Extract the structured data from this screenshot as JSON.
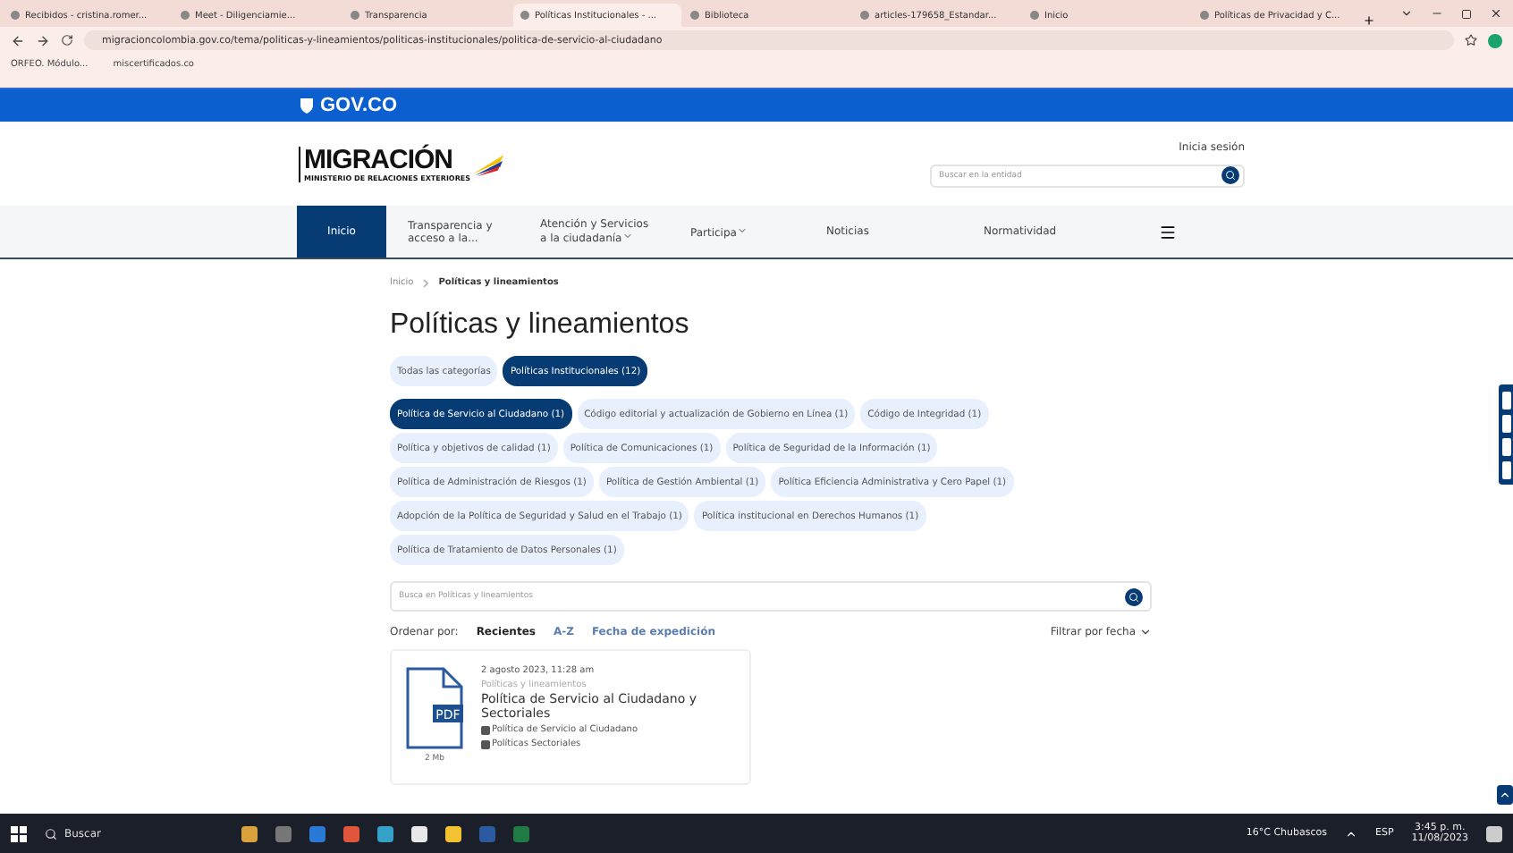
{
  "browser": {
    "tabs": [
      {
        "label": "Recibidos - cristina.romer...",
        "selected": false
      },
      {
        "label": "Meet - Diligenciamie...",
        "selected": false
      },
      {
        "label": "Transparencia",
        "selected": false
      },
      {
        "label": "Políticas Institucionales - ...",
        "selected": true
      },
      {
        "label": "Biblioteca",
        "selected": false
      },
      {
        "label": "articles-179658_Estandar...",
        "selected": false
      },
      {
        "label": "Inicio",
        "selected": false
      },
      {
        "label": "Políticas de Privacidad y C...",
        "selected": false
      }
    ],
    "url": "migracioncolombia.gov.co/tema/politicas-y-lineamientos/politicas-institucionales/politica-de-servicio-al-ciudadano",
    "bookmarks": [
      "ORFEO. Módulo...",
      "miscertificados.co"
    ]
  },
  "gov_bar": {
    "label": "GOV.CO"
  },
  "header": {
    "logo": "MIGRACIÓN",
    "logo_sub": "MINISTERIO DE RELACIONES EXTERIORES",
    "login": "Inicia sesión",
    "search_placeholder": "Buscar en la entidad"
  },
  "nav": [
    {
      "label": "Inicio",
      "selected": true,
      "dropdown": false
    },
    {
      "label": "Transparencia y acceso a la...",
      "selected": false,
      "dropdown": false
    },
    {
      "label": "Atención y Servicios a la ciudadanía",
      "selected": false,
      "dropdown": true
    },
    {
      "label": "Participa",
      "selected": false,
      "dropdown": true
    },
    {
      "label": "Noticias",
      "selected": false,
      "dropdown": false
    },
    {
      "label": "Normatividad",
      "selected": false,
      "dropdown": false
    }
  ],
  "breadcrumb": [
    "Inicio",
    "Políticas y lineamientos"
  ],
  "title": "Políticas y lineamientos",
  "categories": [
    {
      "label": "Todas las categorías",
      "selected": false
    },
    {
      "label": "Políticas Institucionales (12)",
      "selected": true
    }
  ],
  "subcategories": [
    {
      "label": "Política de Servicio al Ciudadano (1)",
      "selected": true
    },
    {
      "label": "Código editorial y actualización de Gobierno en Línea (1)",
      "selected": false
    },
    {
      "label": "Código de Integridad (1)",
      "selected": false
    },
    {
      "label": "Política y objetivos de calidad (1)",
      "selected": false
    },
    {
      "label": "Política de Comunicaciones (1)",
      "selected": false
    },
    {
      "label": "Política de Seguridad de la Información (1)",
      "selected": false
    },
    {
      "label": "Política de Administración de Riesgos (1)",
      "selected": false
    },
    {
      "label": "Política de Gestión Ambiental (1)",
      "selected": false
    },
    {
      "label": "Política Eficiencia Administrativa y Cero Papel (1)",
      "selected": false
    },
    {
      "label": "Adopción de la Política de Seguridad y Salud en el Trabajo (1)",
      "selected": false
    },
    {
      "label": "Política institucional en Derechos Humanos (1)",
      "selected": false
    },
    {
      "label": "Política de Tratamiento de Datos Personales (1)",
      "selected": false
    }
  ],
  "search": {
    "placeholder": "Busca en Políticas y lineamientos"
  },
  "sort": {
    "label": "Ordenar por:",
    "options": [
      {
        "label": "Recientes",
        "selected": true
      },
      {
        "label": "A-Z",
        "selected": false
      },
      {
        "label": "Fecha de expedición",
        "selected": false
      }
    ],
    "filter": "Filtrar por fecha"
  },
  "documents": [
    {
      "date": "2 agosto 2023, 11:28 am",
      "category": "Políticas y lineamientos",
      "title": "Política de Servicio al Ciudadano y Sectoriales",
      "tags": [
        "Política de Servicio al Ciudadano",
        "Políticas Sectoriales"
      ],
      "file_type": "PDF",
      "size": "2 Mb"
    }
  ],
  "taskbar": {
    "search": "Buscar",
    "weather": "16°C  Chubascos",
    "language": "ESP",
    "time": "3:45 p. m.",
    "date": "11/08/2023"
  }
}
